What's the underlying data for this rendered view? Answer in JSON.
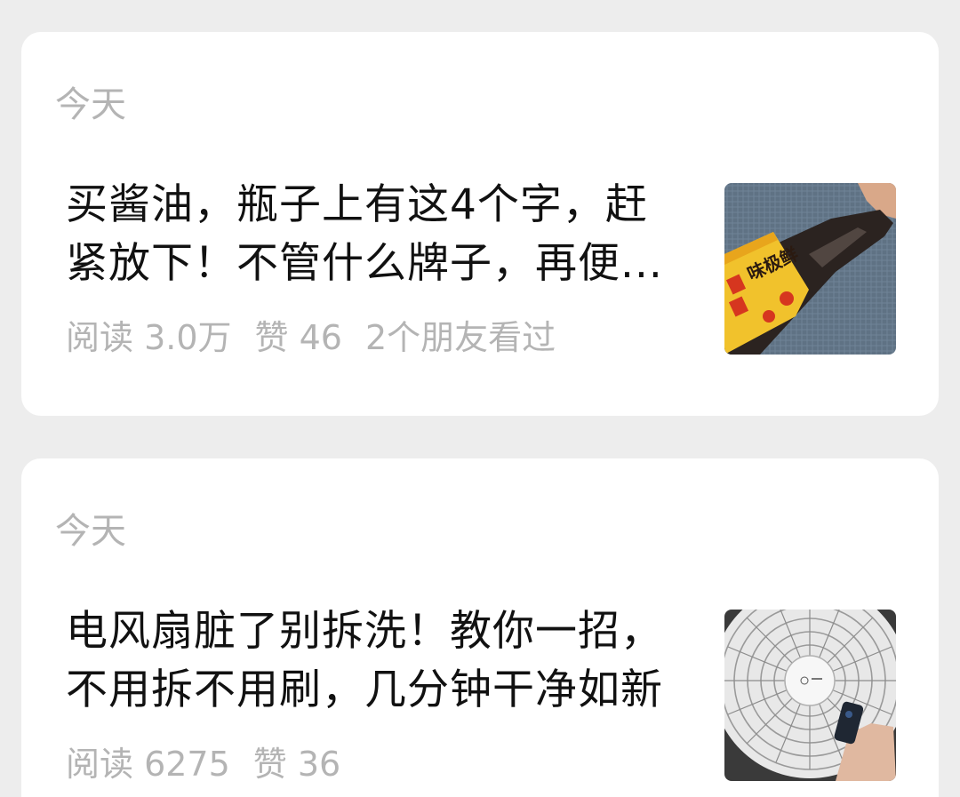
{
  "articles": [
    {
      "date": "今天",
      "title_line1": "买酱油，瓶子上有这4个字，赶",
      "title_line2": "紧放下！不管什么牌子，再便...",
      "reads": "阅读 3.0万",
      "likes": "赞 46",
      "friends": "2个朋友看过",
      "thumbnail": "soy-sauce-bottle-image",
      "label_text": "味极鲜"
    },
    {
      "date": "今天",
      "title_line1": "电风扇脏了别拆洗！教你一招，",
      "title_line2": "不用拆不用刷，几分钟干净如新",
      "reads": "阅读 6275",
      "likes": "赞 36",
      "thumbnail": "electric-fan-image"
    }
  ],
  "colors": {
    "background": "#ededed",
    "card": "#ffffff",
    "title": "#111111",
    "meta": "#b4b4b4"
  }
}
